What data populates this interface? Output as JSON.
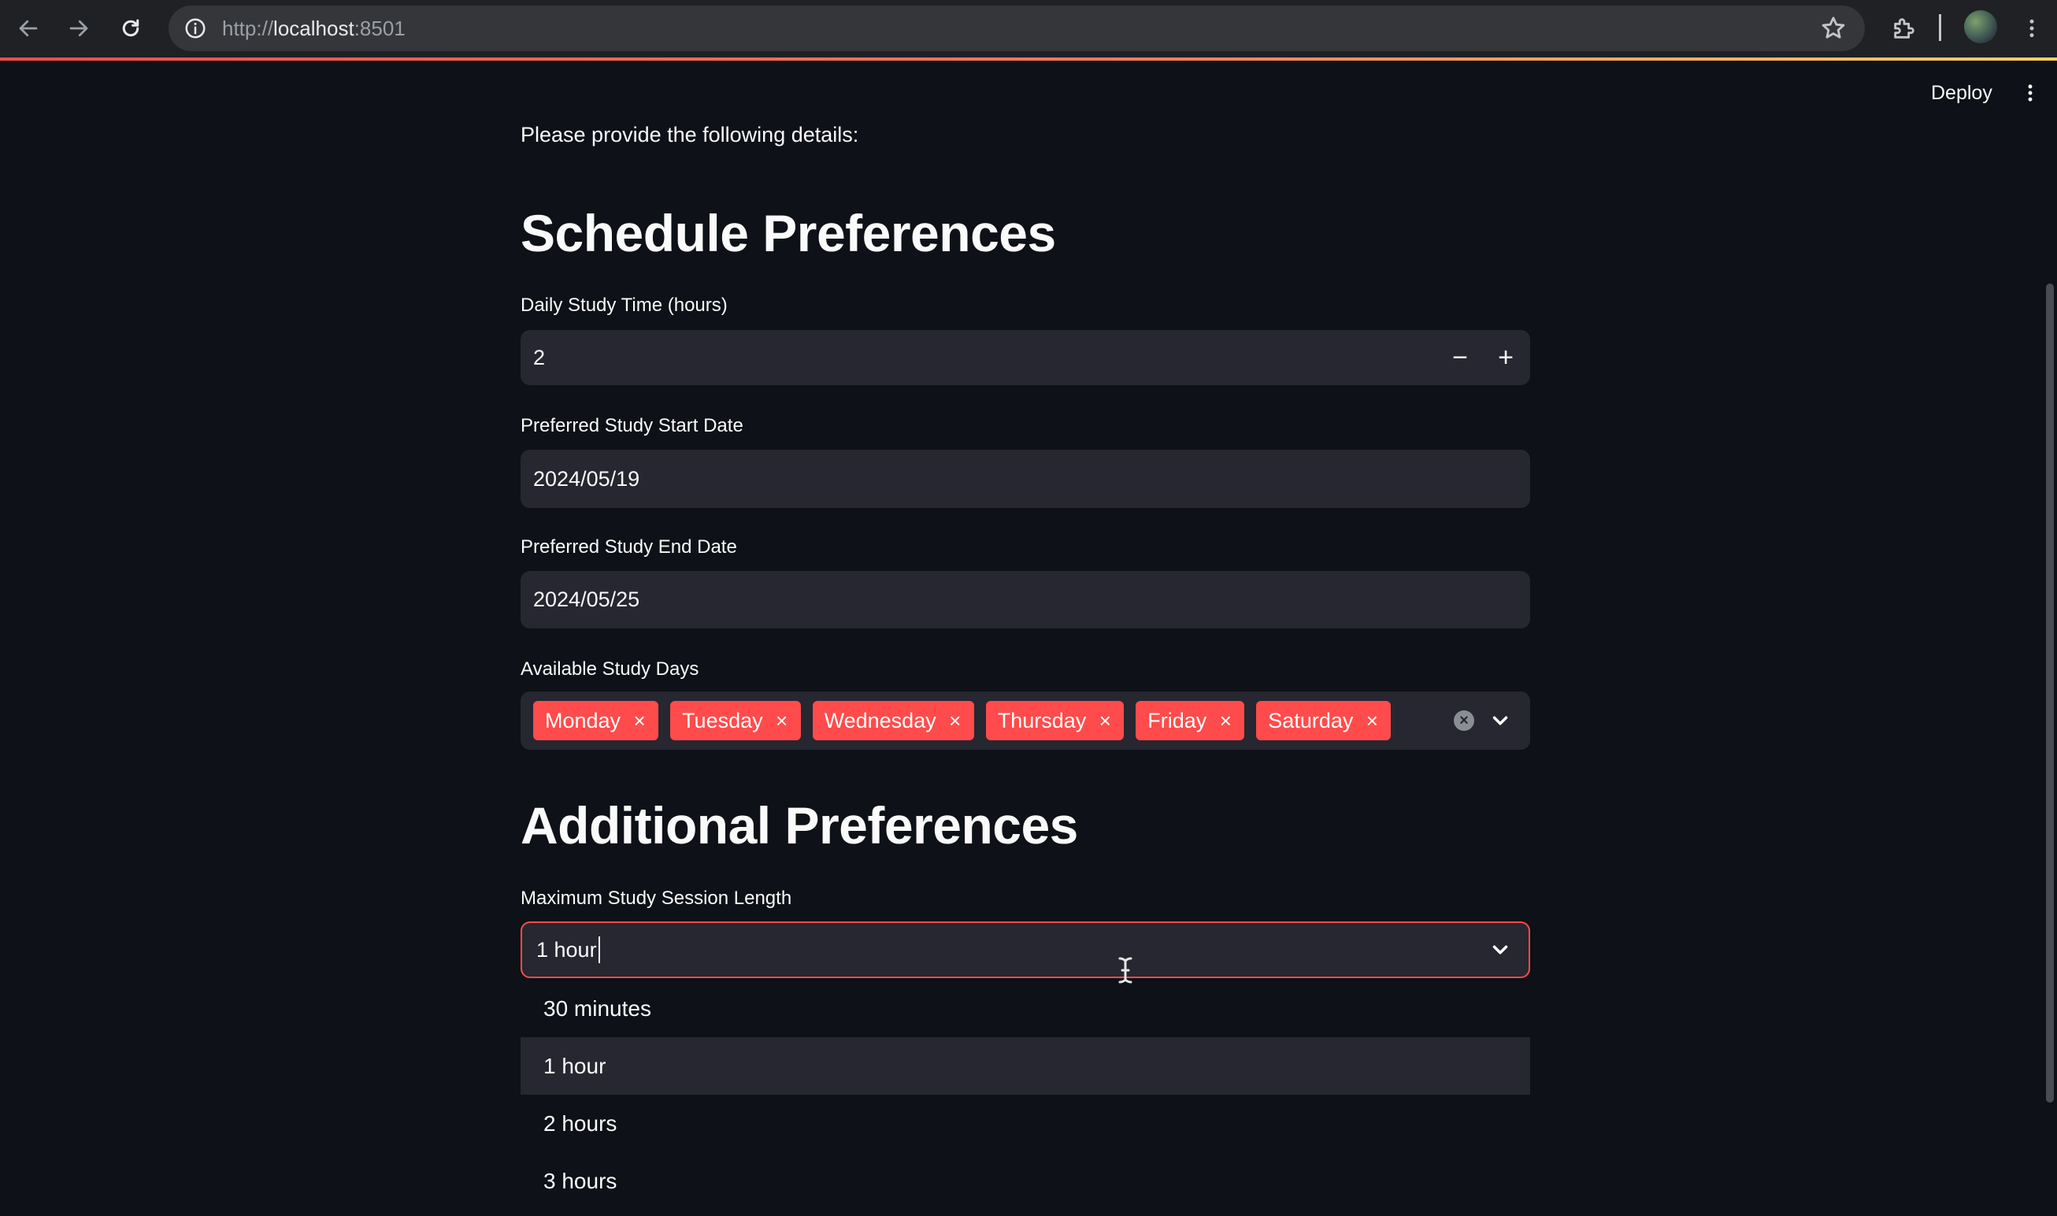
{
  "browser": {
    "url_prefix": "http://",
    "url_host": "localhost",
    "url_port": ":8501",
    "icons": [
      "back-arrow-icon",
      "forward-arrow-icon",
      "reload-icon",
      "site-info-icon",
      "bookmark-star-icon",
      "extensions-icon",
      "profile-avatar",
      "browser-menu-icon"
    ]
  },
  "header": {
    "deploy_label": "Deploy"
  },
  "form": {
    "intro": "Please provide the following details:",
    "schedule_heading": "Schedule Preferences",
    "daily_time": {
      "label": "Daily Study Time (hours)",
      "value": "2",
      "decrement": "−",
      "increment": "+"
    },
    "start_date": {
      "label": "Preferred Study Start Date",
      "value": "2024/05/19"
    },
    "end_date": {
      "label": "Preferred Study End Date",
      "value": "2024/05/25"
    },
    "study_days": {
      "label": "Available Study Days",
      "selected": [
        "Monday",
        "Tuesday",
        "Wednesday",
        "Thursday",
        "Friday",
        "Saturday"
      ],
      "remove_glyph": "×",
      "clear_glyph": "×"
    },
    "additional_heading": "Additional Preferences",
    "session_length": {
      "label": "Maximum Study Session Length",
      "value": "1 hour",
      "options": [
        "30 minutes",
        "1 hour",
        "2 hours",
        "3 hours"
      ],
      "highlighted": "1 hour"
    }
  },
  "colors": {
    "background": "#0e1117",
    "input_bg": "#262730",
    "accent": "#ff4b4b",
    "text": "#fafafa"
  }
}
